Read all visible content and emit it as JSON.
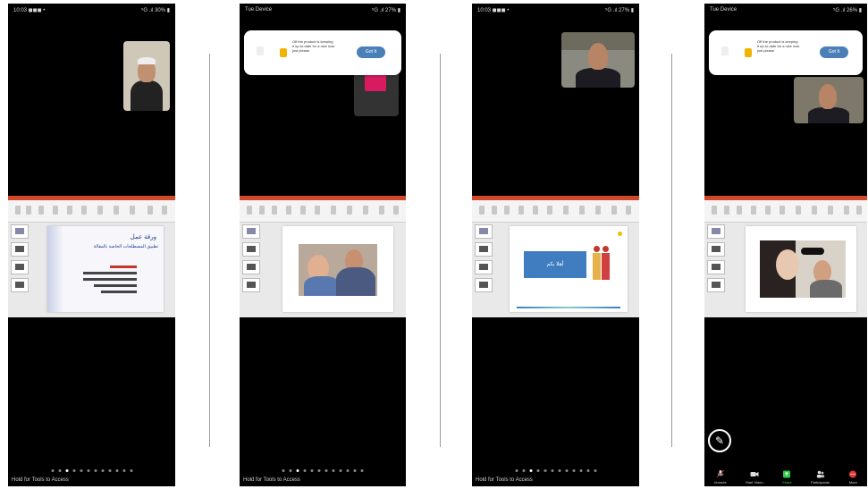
{
  "screens": [
    {
      "status_left": "10:03 ◼◼◼ •",
      "status_right": "⁵G .ıl 30% ▮",
      "slide_arabic_title": "ورقة عمل",
      "slide_arabic_subtitle": "تطبيق المصطلحات الخاصة بالمقالة",
      "bottom_text": "Hold for Tools to Access"
    },
    {
      "status_left": "Tue Device",
      "status_right": "⁵G .ıl 27% ▮",
      "banner_text": "Off the product is keeping it up-to-date for a nice look just please",
      "banner_button": "Got It",
      "bottom_text": "Hold for Tools to Access"
    },
    {
      "status_left": "10:03 ◼◼◼ •",
      "status_right": "⁵G .ıl 27% ▮",
      "slide_box_label": "أهلا بكم",
      "bottom_text": "Hold for Tools to Access"
    },
    {
      "status_left": "Tue Device",
      "status_right": "⁵G .ıl 26% ▮",
      "banner_text": "Off the product is keeping it up-to-date for a nice look just please",
      "banner_button": "Got It",
      "toolbar": [
        "Unmute",
        "Start Video",
        "Share",
        "Participants",
        "More"
      ],
      "bottom_text": "Hold for Tools to Access"
    }
  ]
}
